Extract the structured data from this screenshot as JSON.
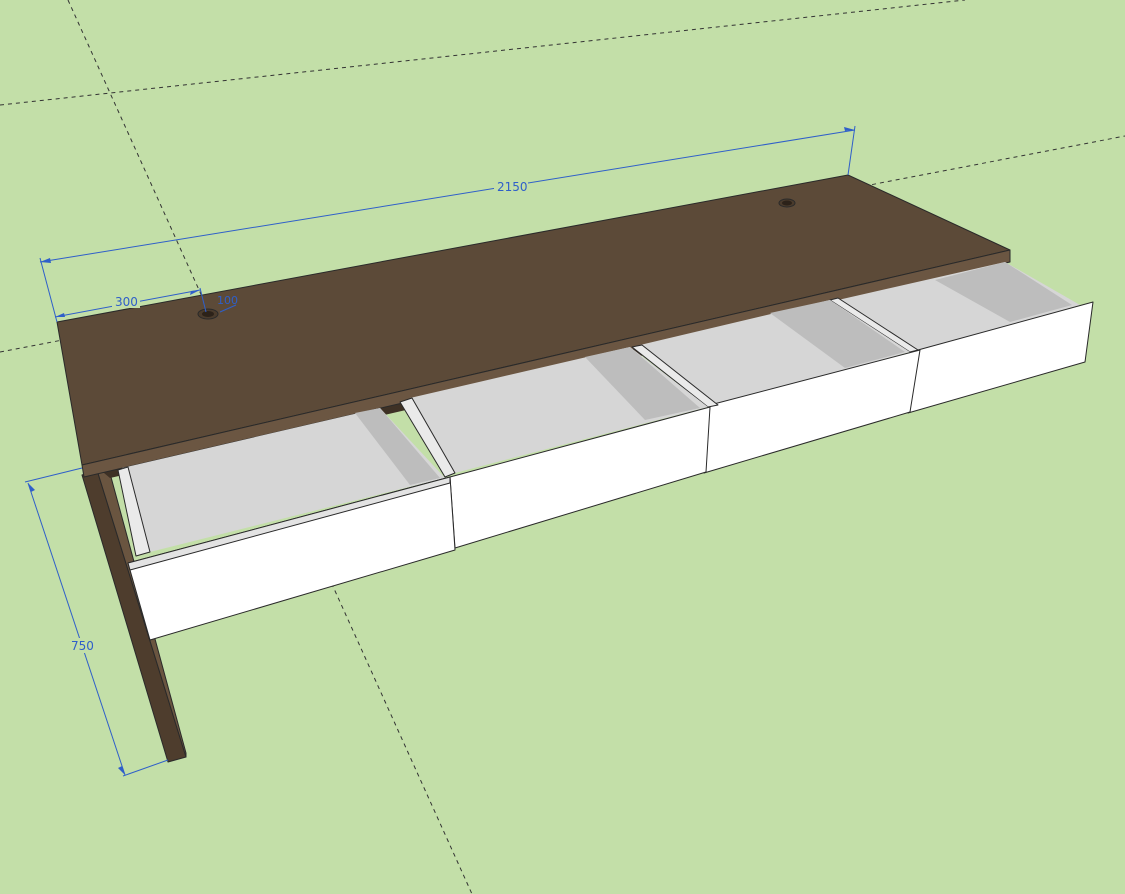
{
  "scene": {
    "background_color": "#c3dfa8",
    "wood_color": "#5c4a38",
    "drawer_color": "#ffffff",
    "drawer_interior_color": "#d4d4d4",
    "dimension_color": "#2f5fc9"
  },
  "dimensions": {
    "overall_length": "2150",
    "hole_offset": "300",
    "hole_diameter": "100",
    "height": "750"
  },
  "objects": {
    "drawer_count": 4,
    "cable_hole_count": 2
  }
}
